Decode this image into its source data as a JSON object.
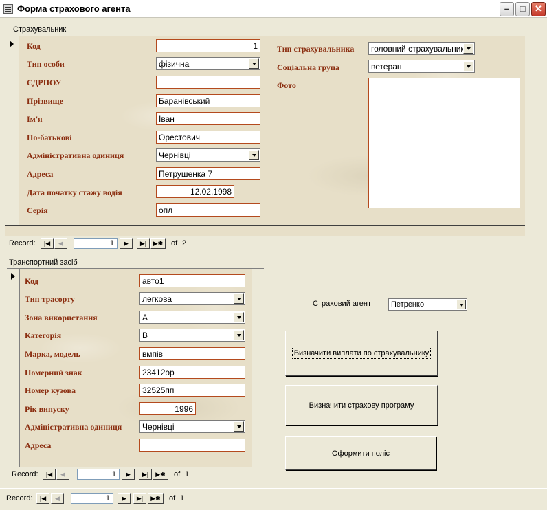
{
  "window": {
    "title": "Форма страхового агента",
    "minimize": "–",
    "maximize": "□",
    "close": "✕"
  },
  "insured": {
    "caption": "Страхувальник",
    "labels": {
      "code": "Код",
      "person_type": "Тип особи",
      "edrpou": "ЄДРПОУ",
      "surname": "Прізвище",
      "name": "Ім'я",
      "patronymic": "По-батькові",
      "admin_unit": "Адміністративна одиниця",
      "address": "Адреса",
      "driving_start": "Дата початку стажу водія",
      "series": "Серія",
      "insured_type": "Тип страхувальника",
      "social_group": "Соціальна група",
      "photo": "Фото"
    },
    "values": {
      "code": "1",
      "person_type": "фізична",
      "edrpou": "",
      "surname": "Баранівський",
      "name": "Іван",
      "patronymic": "Орестович",
      "admin_unit": "Чернівці",
      "address": "Петрушенка 7",
      "driving_start": "12.02.1998",
      "series": "опл",
      "insured_type": "головний страхувальник",
      "social_group": "ветеран"
    },
    "nav": {
      "label": "Record:",
      "current": "1",
      "of": "of",
      "total": "2"
    }
  },
  "vehicle": {
    "caption": "Транспортний засіб",
    "labels": {
      "code": "Код",
      "transport_type": "Тип трасорту",
      "usage_zone": "Зона використання",
      "category": "Категорія",
      "make_model": "Марка, модель",
      "plate": "Номерний знак",
      "body_number": "Номер кузова",
      "year": "Рік випуску",
      "admin_unit": "Адміністративна одиниця",
      "address": "Адреса"
    },
    "values": {
      "code": "авто1",
      "transport_type": "легкова",
      "usage_zone": "А",
      "category": "В",
      "make_model": "вмпів",
      "plate": "23412ор",
      "body_number": "32525пп",
      "year": "1996",
      "admin_unit": "Чернівці",
      "address": ""
    },
    "nav": {
      "label": "Record:",
      "current": "1",
      "of": "of",
      "total": "1"
    }
  },
  "agent": {
    "label": "Страховий агент",
    "value": "Петренко"
  },
  "buttons": {
    "payouts": "Визначити виплати по страхувальнику",
    "program": "Визначити страхову програму",
    "policy": "Оформити поліс"
  },
  "main_nav": {
    "label": "Record:",
    "current": "1",
    "of": "of",
    "total": "1"
  },
  "nav_glyphs": {
    "first": "|◀",
    "prev": "◀",
    "next": "▶",
    "last": "▶|",
    "new": "▶✱"
  },
  "colors": {
    "label": "#8B2E10",
    "field_border": "#B44A1E",
    "subform_bg": "#E7DFC8",
    "form_bg": "#ECE9D8"
  }
}
